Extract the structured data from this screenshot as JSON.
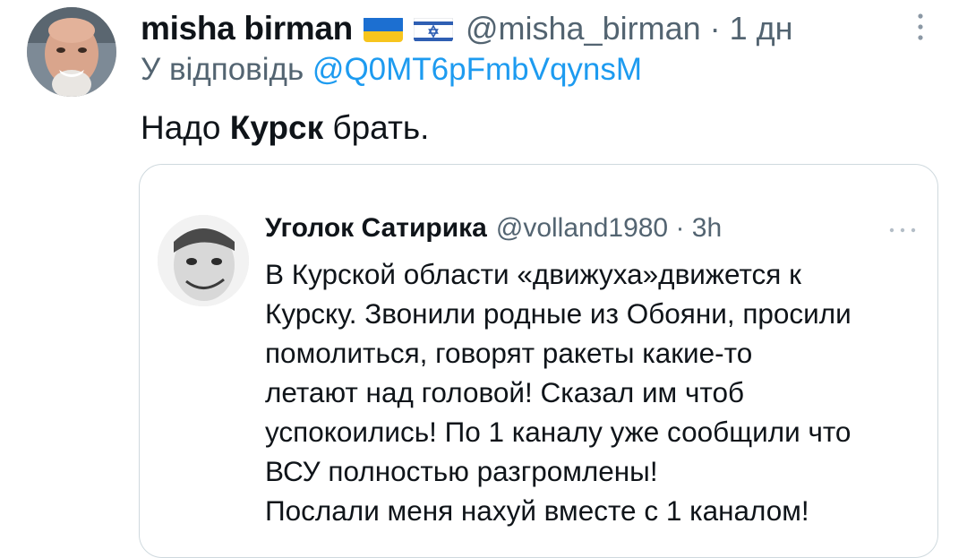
{
  "tweet": {
    "author_name": "misha birman",
    "flags": [
      "ukraine-flag",
      "israel-flag"
    ],
    "handle_time": "@misha_birman · 1 дн",
    "reply_prefix": "У відповідь ",
    "reply_mention": "@Q0MT6pFmbVqynsM",
    "text_before": "Надо ",
    "text_bold": "Курск",
    "text_after": " брать."
  },
  "quoted_tweet": {
    "author_name": "Уголок Сатирика",
    "handle_time": "@volland1980 · 3h",
    "lines": [
      "В Курской области «движуха»движется к",
      "Курску. Звонили родные из Обояни, просили",
      "помолиться, говорят ракеты какие-то",
      "летают над головой! Сказал им чтоб",
      "успокоились! По 1 каналу уже сообщили что",
      "ВСУ полностью разгромлены!",
      "Послали меня нахуй вместе с 1 каналом!"
    ]
  },
  "colors": {
    "text": "#0f1419",
    "secondary": "#536471",
    "link": "#1d9bf0",
    "border": "#cfd9de"
  }
}
